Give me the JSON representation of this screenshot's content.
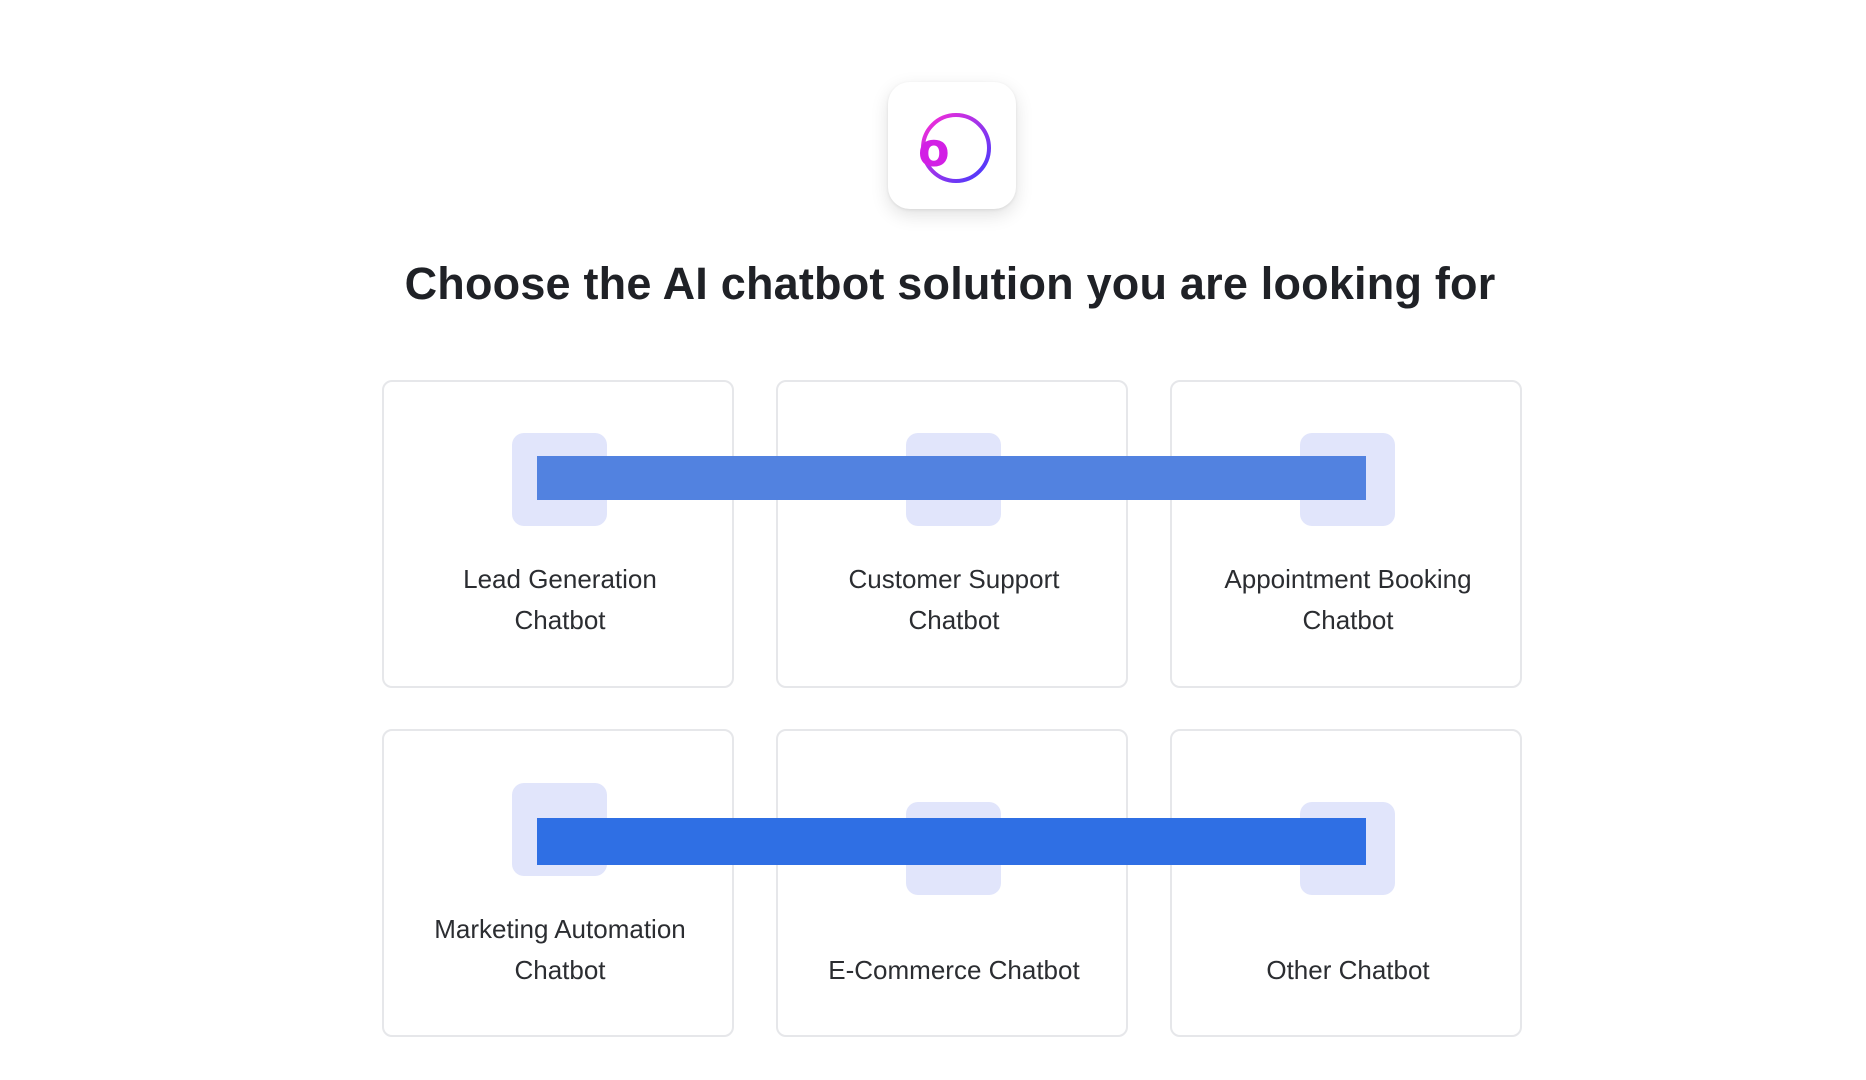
{
  "logo": {
    "icon": "orbit-o-logo",
    "accent_from": "#ff2bd6",
    "accent_to": "#3d3bff"
  },
  "title": "Choose the AI chatbot solution you are looking for",
  "options": [
    {
      "label": "Lead Generation\nChatbot",
      "icon": "thumbs-up-icon"
    },
    {
      "label": "Customer Support\nChatbot",
      "icon": "headset-icon"
    },
    {
      "label": "Appointment Booking\nChatbot",
      "icon": "calendar-icon"
    },
    {
      "label": "Marketing Automation\nChatbot",
      "icon": "megaphone-icon"
    },
    {
      "label": "E-Commerce Chatbot",
      "icon": "cart-icon"
    },
    {
      "label": "Other Chatbot",
      "icon": "chat-bubble-icon"
    }
  ],
  "colors": {
    "icon_tile_bg": "#e1e5fb",
    "redaction_top": "#5282e0",
    "redaction_bottom": "#2f6fe4"
  }
}
